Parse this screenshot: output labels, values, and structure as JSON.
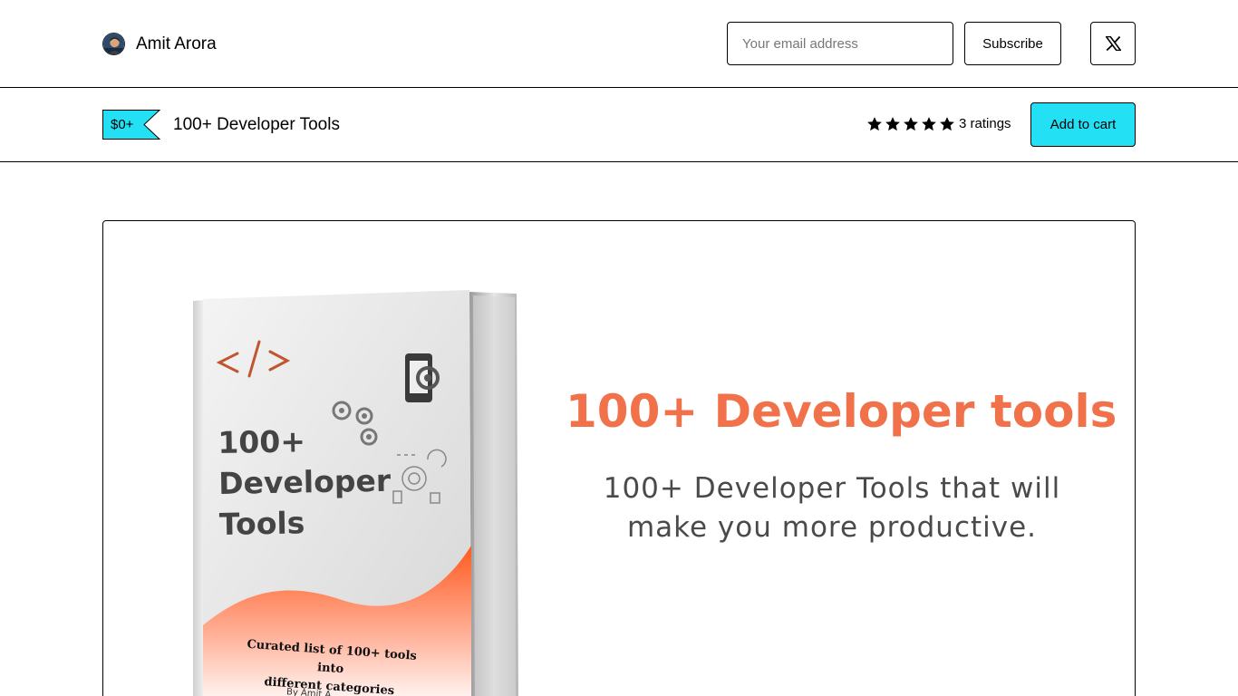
{
  "header": {
    "creator_name": "Amit Arora",
    "email_placeholder": "Your email address",
    "subscribe_label": "Subscribe",
    "social_icon": "x-logo-icon"
  },
  "product": {
    "price": "$0+",
    "title": "100+ Developer Tools",
    "rating_stars": 5,
    "rating_text": "3 ratings",
    "add_to_cart_label": "Add to cart"
  },
  "preview": {
    "book": {
      "title_lines": [
        "100+",
        "Developer",
        "Tools"
      ],
      "subtitle_lines": [
        "Curated list of 100+ tools into",
        "different categories"
      ],
      "author": "By Amit A"
    },
    "headline": "100+ Developer tools",
    "tagline_lines": [
      "100+ Developer Tools that will",
      "make you more productive."
    ]
  },
  "colors": {
    "accent": "#23e0f5",
    "headline": "#f0714a",
    "cover_gradient": "#ff5a1f",
    "text": "#000000"
  }
}
